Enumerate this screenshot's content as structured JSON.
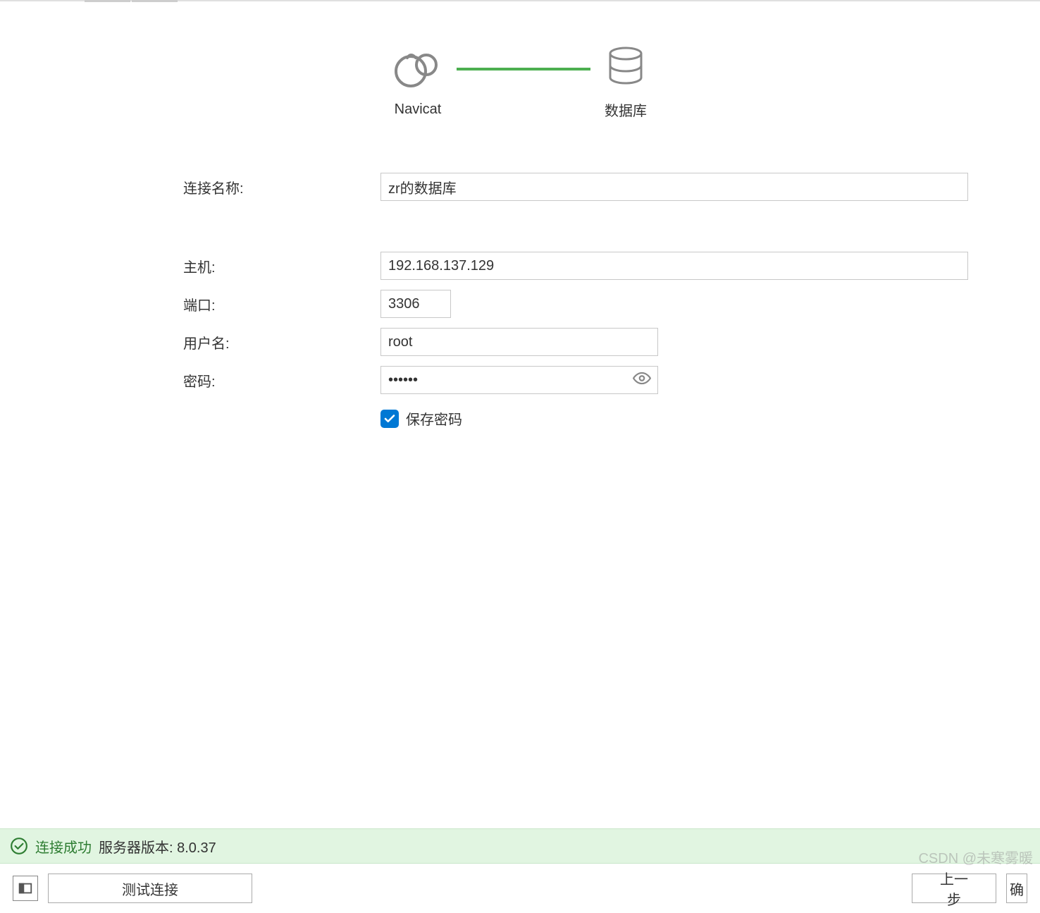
{
  "header": {
    "navicat_label": "Navicat",
    "database_label": "数据库"
  },
  "form": {
    "connection_name_label": "连接名称:",
    "connection_name_value": "zr的数据库",
    "host_label": "主机:",
    "host_value": "192.168.137.129",
    "port_label": "端口:",
    "port_value": "3306",
    "username_label": "用户名:",
    "username_value": "root",
    "password_label": "密码:",
    "password_value": "••••••",
    "save_password_label": "保存密码",
    "save_password_checked": true
  },
  "status": {
    "success_text": "连接成功",
    "version_text": "服务器版本: 8.0.37"
  },
  "buttons": {
    "test_connection": "测试连接",
    "prev_step": "上一步",
    "ok": "确"
  },
  "watermark": "CSDN @未寒雾暖"
}
